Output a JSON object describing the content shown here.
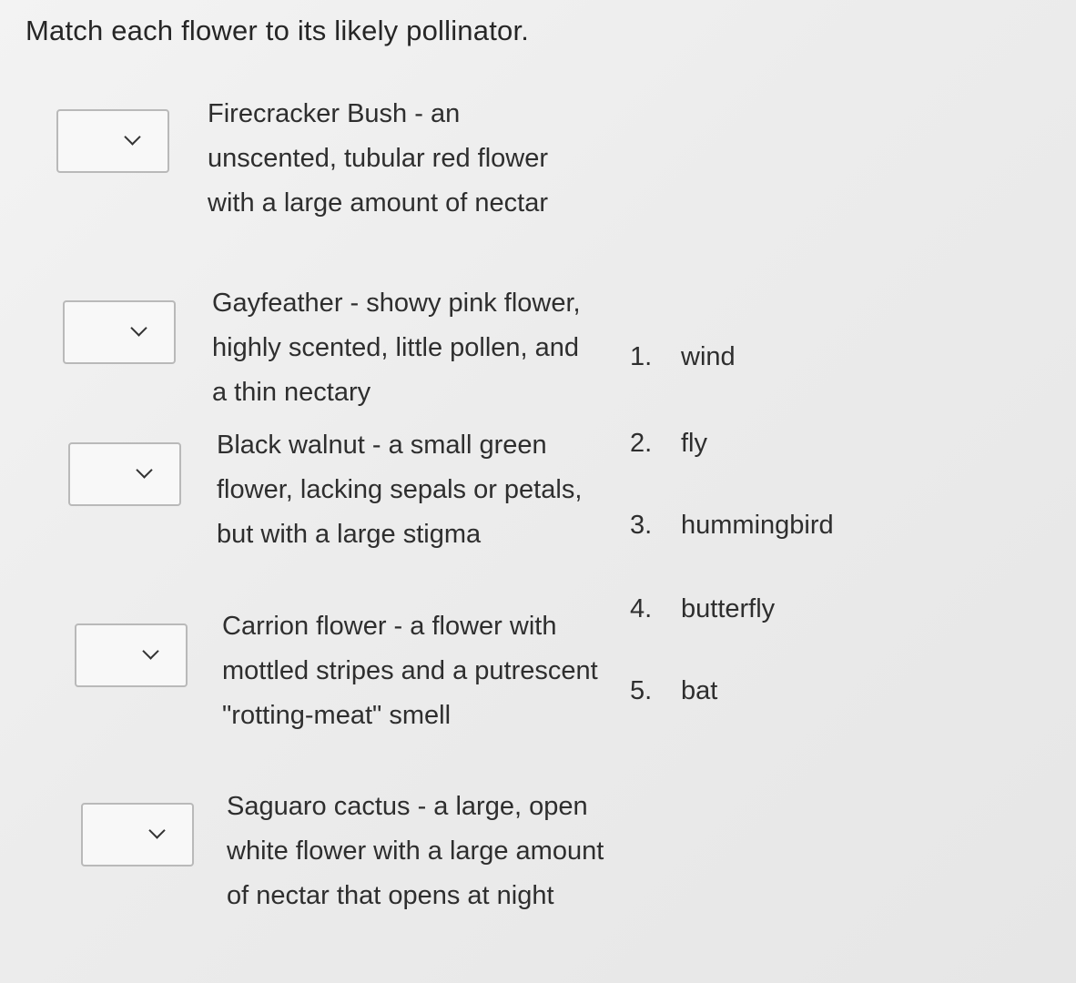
{
  "question": {
    "prompt": "Match each flower to its likely pollinator."
  },
  "flowers": [
    {
      "description": "Firecracker Bush - an unscented, tubular red flower with a large amount of nectar",
      "selected": ""
    },
    {
      "description": "Gayfeather - showy pink flower, highly scented, little pollen, and a thin nectary",
      "selected": ""
    },
    {
      "description": "Black walnut - a small green flower, lacking sepals or petals, but with a large stigma",
      "selected": ""
    },
    {
      "description": "Carrion flower - a flower with mottled stripes and a putrescent \"rotting-meat\" smell",
      "selected": ""
    },
    {
      "description": "Saguaro cactus - a large, open white flower with a large amount of nectar that opens at night",
      "selected": ""
    }
  ],
  "pollinators": [
    {
      "number": "1.",
      "label": "wind"
    },
    {
      "number": "2.",
      "label": "fly"
    },
    {
      "number": "3.",
      "label": "hummingbird"
    },
    {
      "number": "4.",
      "label": "butterfly"
    },
    {
      "number": "5.",
      "label": "bat"
    }
  ],
  "icons": {
    "dropdown": "chevron-down-icon"
  }
}
